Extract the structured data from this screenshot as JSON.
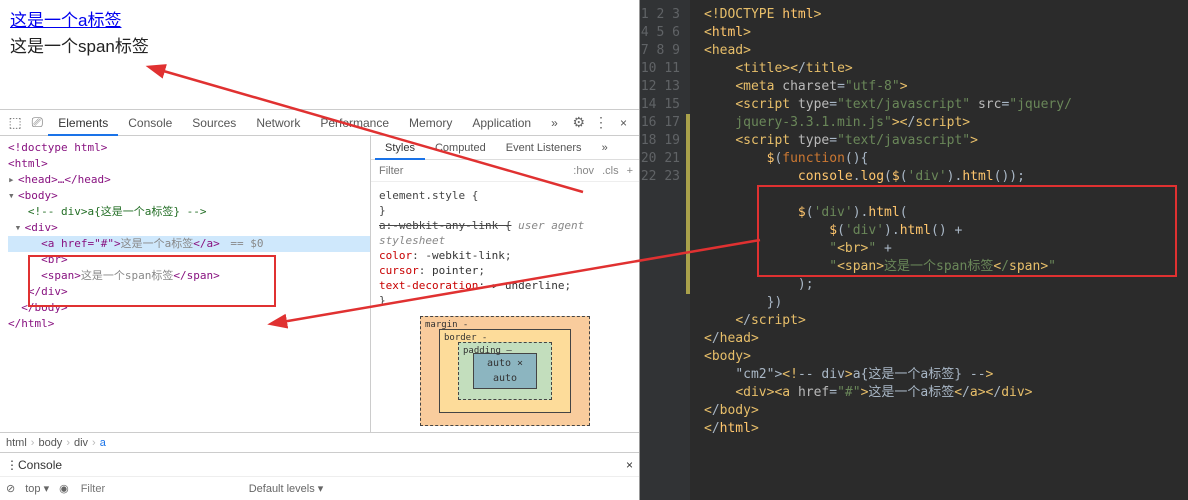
{
  "page": {
    "link_text": "这是一个a标签",
    "span_text": "这是一个span标签"
  },
  "devtools": {
    "tabs": [
      "Elements",
      "Console",
      "Sources",
      "Network",
      "Performance",
      "Memory",
      "Application"
    ],
    "active_tab": "Elements",
    "more": "»",
    "gear": "⚙",
    "close": "×",
    "dom": {
      "doctype": "<!doctype html>",
      "html_open": "<html>",
      "head": "<head>…</head>",
      "body_open": "<body>",
      "comment": "<!-- div>a{这是一个a标签} -->",
      "div_open": "<div>",
      "a_line": {
        "open": "<a href=\"#\">",
        "text": "这是一个a标签",
        "close": "</a>",
        "eq": " == $0"
      },
      "br": "<br>",
      "span_line": {
        "open": "<span>",
        "text": "这是一个span标签",
        "close": "</span>"
      },
      "div_close": "</div>",
      "body_close": "</body>",
      "html_close": "</html>"
    },
    "styles": {
      "tabs": [
        "Styles",
        "Computed",
        "Event Listeners"
      ],
      "active": "Styles",
      "filter_placeholder": "Filter",
      "hov": ":hov",
      "cls": ".cls",
      "plus": "+",
      "rule1": "element.style {",
      "rule1_close": "}",
      "rule2_sel": "a:-webkit-any-link {",
      "rule2_note": "user agent stylesheet",
      "props": [
        {
          "p": "color",
          "v": "-webkit-link"
        },
        {
          "p": "cursor",
          "v": "pointer"
        },
        {
          "p": "text-decoration",
          "v": "▸ underline"
        }
      ],
      "close": "}",
      "box": {
        "margin": "margin       -",
        "border": "border    -",
        "padding": "padding –",
        "content": "auto × auto"
      }
    },
    "breadcrumb": [
      "html",
      "body",
      "div",
      "a"
    ],
    "console_label": "Console",
    "console_bar": {
      "ban": "⊘",
      "top": "top",
      "eye": "◉",
      "filter": "Filter",
      "levels": "Default levels ▾"
    }
  },
  "editor": {
    "lines": [
      "<!DOCTYPE html>",
      "<html>",
      "<head>",
      "    <title></title>",
      "    <meta charset=\"utf-8\">",
      "    <script type=\"text/javascript\" src=\"jquery/\n    jquery-3.3.1.min.js\"></script>",
      "    <script type=\"text/javascript\">",
      "        $(function(){",
      "            console.log($('div').html());",
      "",
      "            $('div').html(",
      "                $('div').html() +",
      "                \"<br>\" +",
      "                \"<span>这是一个span标签</span>\"",
      "            );",
      "        })",
      "    </script>",
      "</head>",
      "<body>",
      "    <!-- div>a{这是一个a标签} -->",
      "    <div><a href=\"#\">这是一个a标签</a></div>",
      "</body>",
      "</html>"
    ],
    "line_count": 23
  }
}
